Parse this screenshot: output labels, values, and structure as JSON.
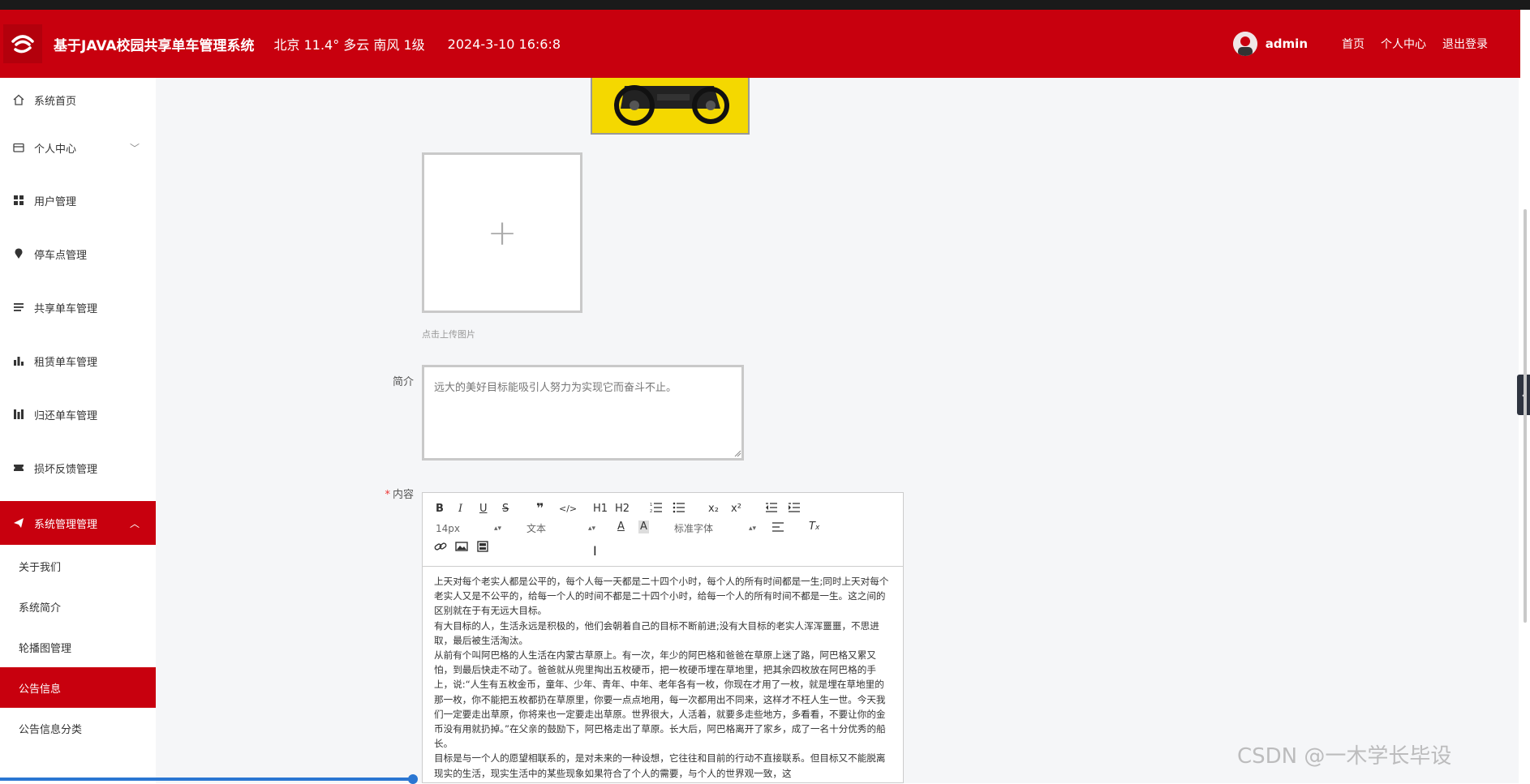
{
  "header": {
    "title": "基于JAVA校园共享单车管理系统",
    "weather": "北京  11.4°  多云  南风  1级",
    "datetime": "2024-3-10 16:6:8",
    "username": "admin",
    "nav": [
      "首页",
      "个人中心",
      "退出登录"
    ],
    "colors": {
      "brand": "#c8000e"
    }
  },
  "sidebar": {
    "items": [
      {
        "label": "系统首页",
        "icon": "home-icon"
      },
      {
        "label": "个人中心",
        "icon": "card-icon"
      },
      {
        "label": "用户管理",
        "icon": "grid-icon"
      },
      {
        "label": "停车点管理",
        "icon": "location-icon"
      },
      {
        "label": "共享单车管理",
        "icon": "list-icon"
      },
      {
        "label": "租赁单车管理",
        "icon": "bar-chart-icon"
      },
      {
        "label": "归还单车管理",
        "icon": "columns-icon"
      },
      {
        "label": "损坏反馈管理",
        "icon": "ticket-icon"
      },
      {
        "label": "系统管理管理",
        "icon": "send-icon"
      }
    ],
    "subitems": [
      {
        "label": "关于我们"
      },
      {
        "label": "系统简介"
      },
      {
        "label": "轮播图管理"
      },
      {
        "label": "公告信息"
      },
      {
        "label": "公告信息分类"
      }
    ]
  },
  "form": {
    "upload_hint": "点击上传图片",
    "intro_label": "简介",
    "intro_placeholder": "远大的美好目标能吸引人努力为实现它而奋斗不止。",
    "content_label": "内容",
    "required_mark": "*"
  },
  "editor": {
    "font_size": "14px",
    "block_type": "文本",
    "font_family": "标准字体",
    "tool_labels": {
      "h1": "H1",
      "h2": "H2",
      "sub": "x₂",
      "sup": "x²"
    },
    "paragraphs": [
      "上天对每个老实人都是公平的，每个人每一天都是二十四个小时，每个人的所有时间都是一生;同时上天对每个老实人又是不公平的，给每一个人的时间不都是二十四个小时，给每一个人的所有时间不都是一生。这之间的区别就在于有无远大目标。",
      "有大目标的人，生活永远是积极的，他们会朝着自己的目标不断前进;没有大目标的老实人浑浑噩噩，不思进取，最后被生活淘汰。",
      "从前有个叫阿巴格的人生活在内蒙古草原上。有一次，年少的阿巴格和爸爸在草原上迷了路，阿巴格又累又怕，到最后快走不动了。爸爸就从兜里掏出五枚硬币，把一枚硬币埋在草地里，把其余四枚放在阿巴格的手上，说:“人生有五枚金币，童年、少年、青年、中年、老年各有一枚，你现在才用了一枚，就是埋在草地里的那一枚，你不能把五枚都扔在草原里，你要一点点地用，每一次都用出不同来，这样才不枉人生一世。今天我们一定要走出草原，你将来也一定要走出草原。世界很大，人活着，就要多走些地方，多看看，不要让你的金币没有用就扔掉。”在父亲的鼓励下，阿巴格走出了草原。长大后，阿巴格离开了家乡，成了一名十分优秀的船长。",
      "目标是与一个人的愿望相联系的，是对未来的一种设想，它往往和目前的行动不直接联系。但目标又不能脱离现实的生活，现实生活中的某些现象如果符合了个人的需要，与个人的世界观一致，这"
    ]
  },
  "watermark": "CSDN @一木学长毕设"
}
